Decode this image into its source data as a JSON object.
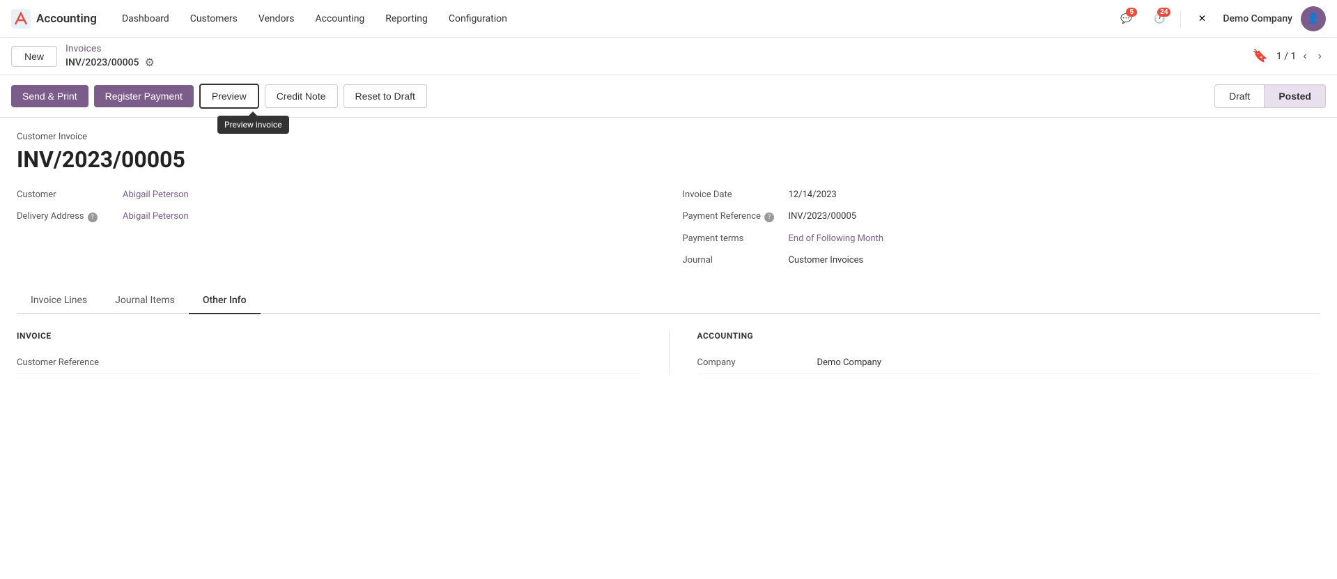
{
  "app": {
    "logo_text": "✕",
    "name": "Accounting"
  },
  "topnav": {
    "menu_items": [
      "Dashboard",
      "Customers",
      "Vendors",
      "Accounting",
      "Reporting",
      "Configuration"
    ],
    "notifications": [
      {
        "icon": "💬",
        "count": "5"
      },
      {
        "icon": "🕐",
        "count": "24"
      }
    ],
    "tools_icon": "⚙",
    "company": "Demo Company"
  },
  "record_nav": {
    "new_label": "New",
    "breadcrumb": "Invoices",
    "record_id": "INV/2023/00005",
    "pager": "1 / 1"
  },
  "action_bar": {
    "send_print": "Send & Print",
    "register_payment": "Register Payment",
    "preview": "Preview",
    "credit_note": "Credit Note",
    "reset_to_draft": "Reset to Draft",
    "status_draft": "Draft",
    "status_posted": "Posted",
    "tooltip": "Preview invoice"
  },
  "invoice": {
    "doc_type": "Customer Invoice",
    "doc_number": "INV/2023/00005",
    "customer_label": "Customer",
    "customer_value": "Abigail Peterson",
    "delivery_label": "Delivery Address",
    "delivery_value": "Abigail Peterson",
    "invoice_date_label": "Invoice Date",
    "invoice_date_value": "12/14/2023",
    "payment_ref_label": "Payment Reference",
    "payment_ref_value": "INV/2023/00005",
    "payment_terms_label": "Payment terms",
    "payment_terms_value": "End of Following Month",
    "journal_label": "Journal",
    "journal_value": "Customer Invoices"
  },
  "tabs": [
    {
      "id": "invoice-lines",
      "label": "Invoice Lines"
    },
    {
      "id": "journal-items",
      "label": "Journal Items"
    },
    {
      "id": "other-info",
      "label": "Other Info"
    }
  ],
  "other_info": {
    "invoice_section_title": "INVOICE",
    "accounting_section_title": "ACCOUNTING",
    "customer_reference_label": "Customer Reference",
    "customer_reference_value": "",
    "company_label": "Company",
    "company_value": "Demo Company"
  }
}
